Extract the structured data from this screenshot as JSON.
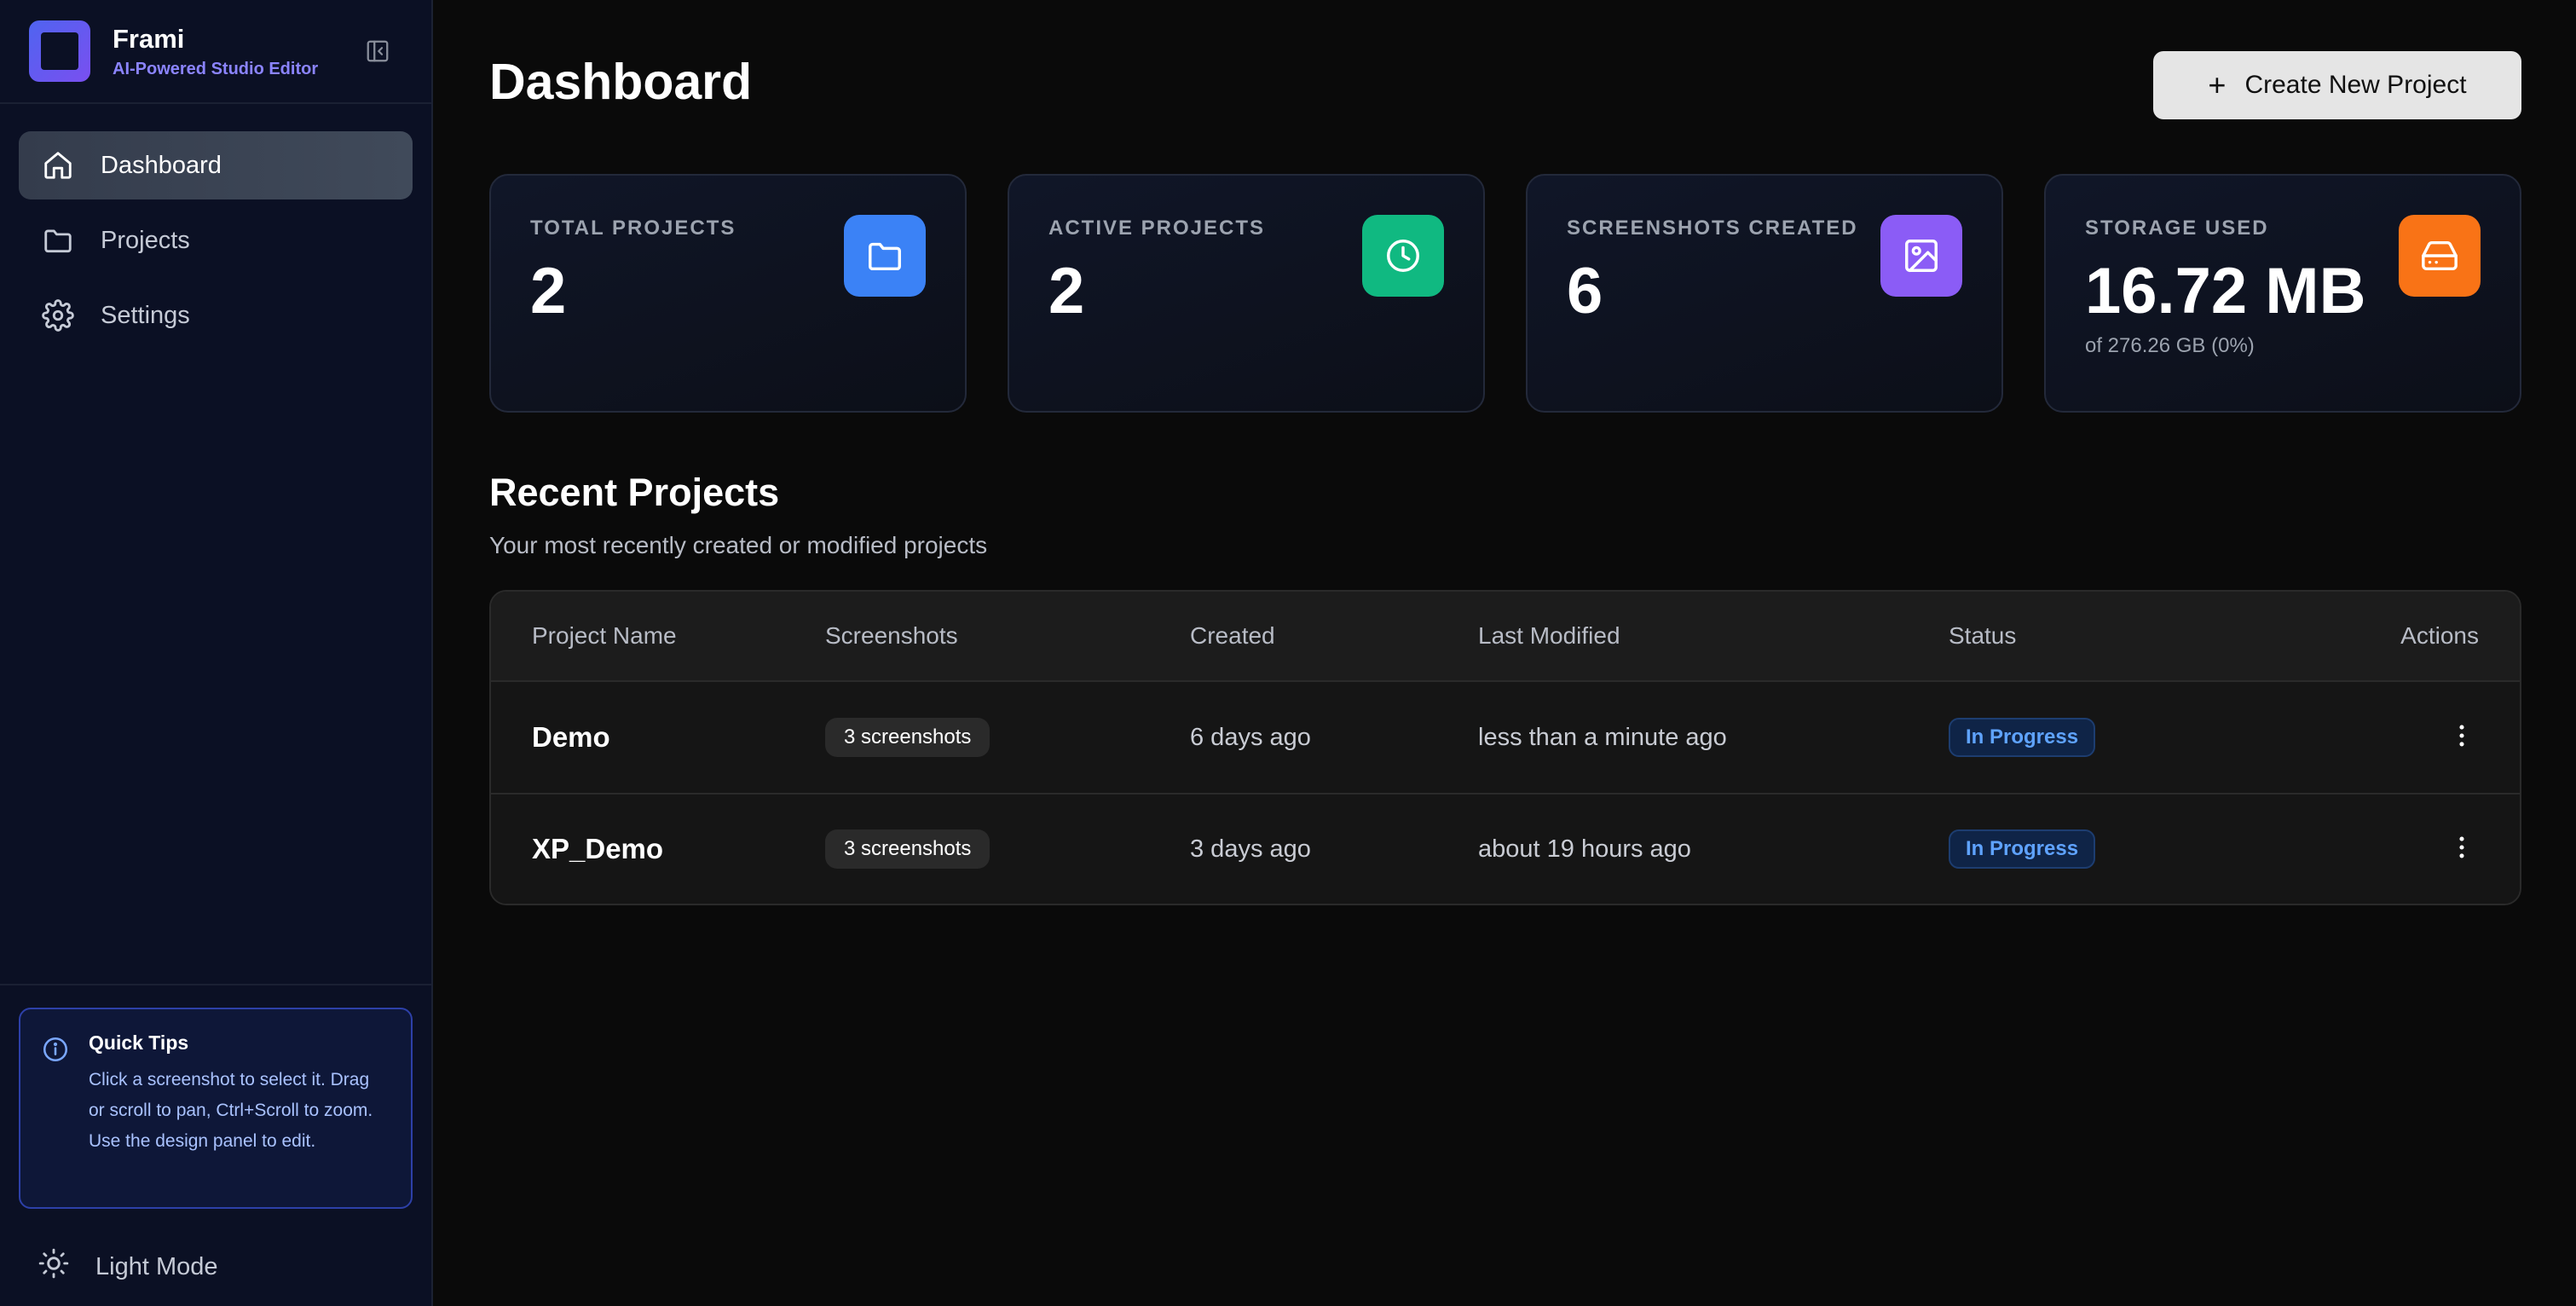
{
  "app": {
    "name": "Frami",
    "tagline": "AI-Powered Studio Editor"
  },
  "sidebar": {
    "items": [
      {
        "label": "Dashboard",
        "icon": "home-icon",
        "active": true
      },
      {
        "label": "Projects",
        "icon": "folder-icon",
        "active": false
      },
      {
        "label": "Settings",
        "icon": "gear-icon",
        "active": false
      }
    ],
    "tips": {
      "title": "Quick Tips",
      "text": "Click a screenshot to select it. Drag or scroll to pan, Ctrl+Scroll to zoom. Use the design panel to edit."
    },
    "theme_toggle": "Light Mode"
  },
  "header": {
    "title": "Dashboard",
    "create_button": "Create New Project"
  },
  "stats": [
    {
      "label": "TOTAL PROJECTS",
      "value": "2",
      "sub": "",
      "icon": "folder-icon",
      "color": "#3b82f6"
    },
    {
      "label": "ACTIVE PROJECTS",
      "value": "2",
      "sub": "",
      "icon": "clock-icon",
      "color": "#10b981"
    },
    {
      "label": "SCREENSHOTS CREATED",
      "value": "6",
      "sub": "",
      "icon": "image-icon",
      "color": "#8b5cf6"
    },
    {
      "label": "STORAGE USED",
      "value": "16.72 MB",
      "sub": "of 276.26 GB (0%)",
      "icon": "hard-drive-icon",
      "color": "#f97316"
    }
  ],
  "recent": {
    "title": "Recent Projects",
    "subtitle": "Your most recently created or modified projects",
    "columns": [
      "Project Name",
      "Screenshots",
      "Created",
      "Last Modified",
      "Status",
      "Actions"
    ],
    "rows": [
      {
        "name": "Demo",
        "screenshots": "3 screenshots",
        "created": "6 days ago",
        "modified": "less than a minute ago",
        "status": "In Progress"
      },
      {
        "name": "XP_Demo",
        "screenshots": "3 screenshots",
        "created": "3 days ago",
        "modified": "about 19 hours ago",
        "status": "In Progress"
      }
    ]
  },
  "colors": {
    "status_text": "#5fa3ff",
    "accent": "#8b84ff"
  }
}
